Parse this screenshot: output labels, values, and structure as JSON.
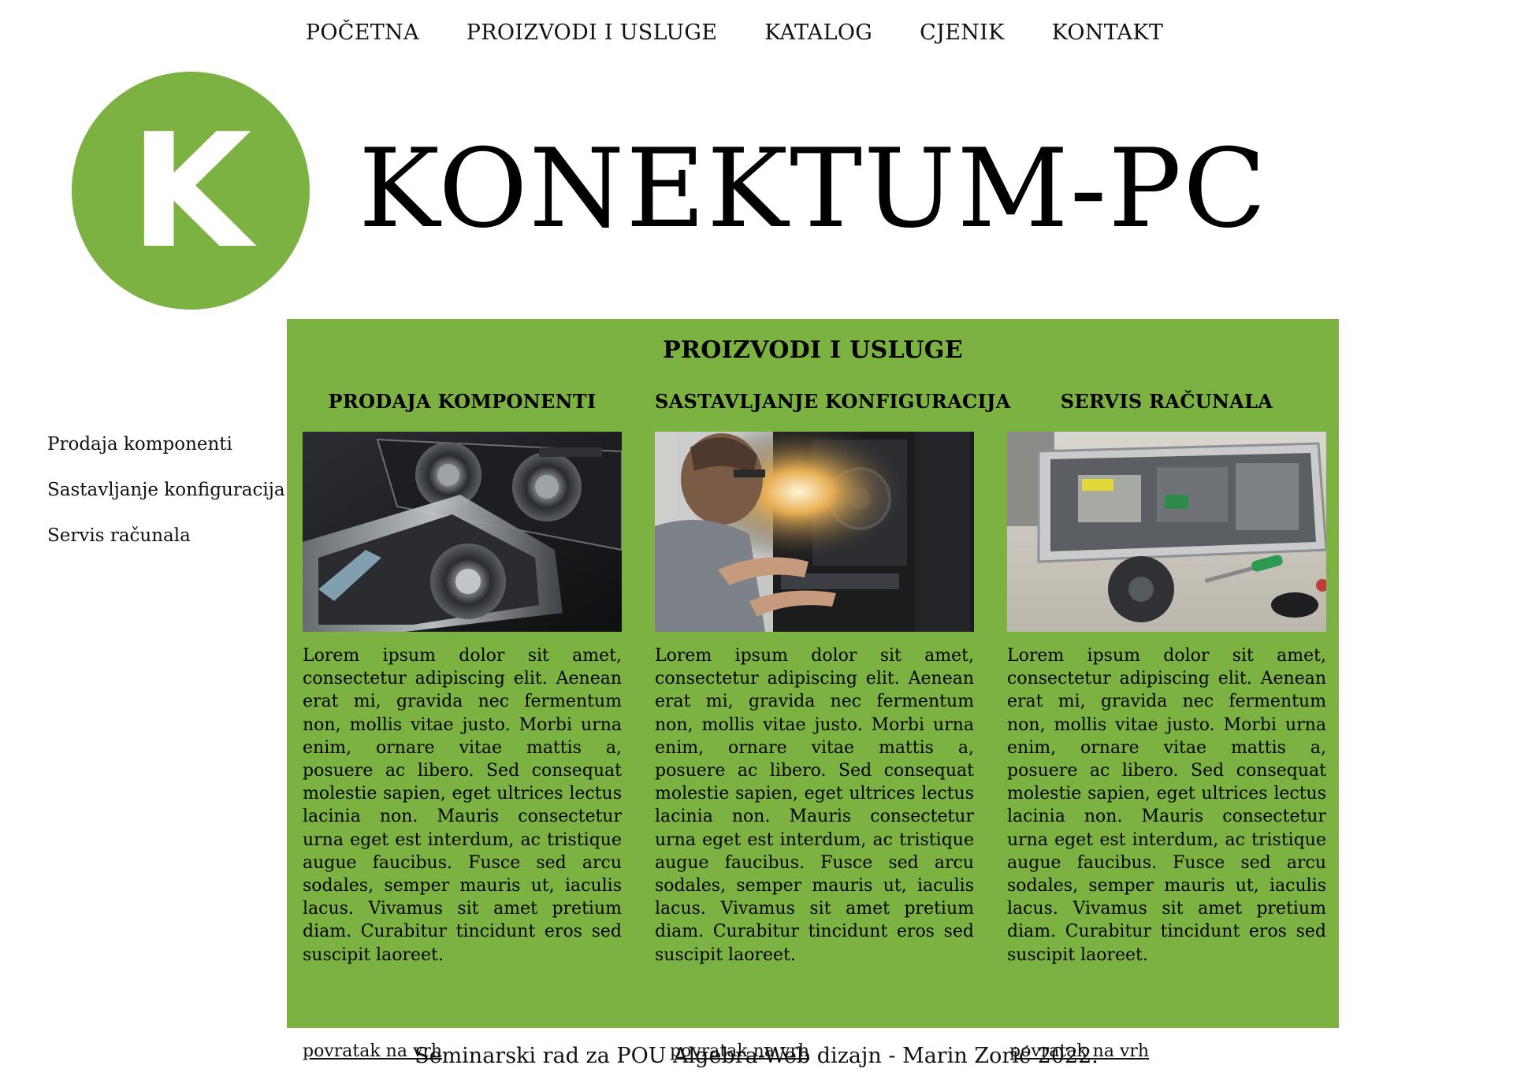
{
  "nav": {
    "items": [
      "POČETNA",
      "PROIZVODI I USLUGE",
      "KATALOG",
      "CJENIK",
      "KONTAKT"
    ]
  },
  "header": {
    "logo_letter": "K",
    "brand": "KONEKTUM-PC"
  },
  "sidebar": {
    "items": [
      "Prodaja komponenti",
      "Sastavljanje konfiguracija",
      "Servis računala"
    ]
  },
  "main": {
    "title": "PROIZVODI I USLUGE",
    "columns": [
      {
        "heading": "PRODAJA KOMPONENTI",
        "image": "graphics-cards-photo",
        "text": "Lorem ipsum dolor sit amet, consectetur adipiscing elit. Aenean erat mi, gravida nec fermentum non, mollis vitae justo. Morbi urna enim, ornare vitae mattis a, posuere ac libero. Sed consequat molestie sapien, eget ultrices lectus lacinia non. Mauris consectetur urna eget est interdum, ac tristique augue faucibus. Fusce sed arcu sodales, semper mauris ut, iaculis lacus. Vivamus sit amet pretium diam. Curabitur tincidunt eros sed suscipit laoreet.",
        "back_link": "povratak na vrh"
      },
      {
        "heading": "SASTAVLJANJE KONFIGURACIJA",
        "image": "technician-assembling-pc-photo",
        "text": "Lorem ipsum dolor sit amet, consectetur adipiscing elit. Aenean erat mi, gravida nec fermentum non, mollis vitae justo. Morbi urna enim, ornare vitae mattis a, posuere ac libero. Sed consequat molestie sapien, eget ultrices lectus lacinia non. Mauris consectetur urna eget est interdum, ac tristique augue faucibus. Fusce sed arcu sodales, semper mauris ut, iaculis lacus. Vivamus sit amet pretium diam. Curabitur tincidunt eros sed suscipit laoreet.",
        "back_link": "povratak na vrh"
      },
      {
        "heading": "SERVIS RAČUNALA",
        "image": "opened-computer-repair-photo",
        "text": "Lorem ipsum dolor sit amet, consectetur adipiscing elit. Aenean erat mi, gravida nec fermentum non, mollis vitae justo. Morbi urna enim, ornare vitae mattis a, posuere ac libero. Sed consequat molestie sapien, eget ultrices lectus lacinia non. Mauris consectetur urna eget est interdum, ac tristique augue faucibus. Fusce sed arcu sodales, semper mauris ut, iaculis lacus. Vivamus sit amet pretium diam. Curabitur tincidunt eros sed suscipit laoreet.",
        "back_link": "povratak na vrh"
      }
    ]
  },
  "footer": {
    "text": "Seminarski rad za POU Algebra-Web dizajn - Marin Zorić 2022."
  },
  "colors": {
    "accent": "#7bb241",
    "background": "#ffffff",
    "text": "#000000"
  }
}
